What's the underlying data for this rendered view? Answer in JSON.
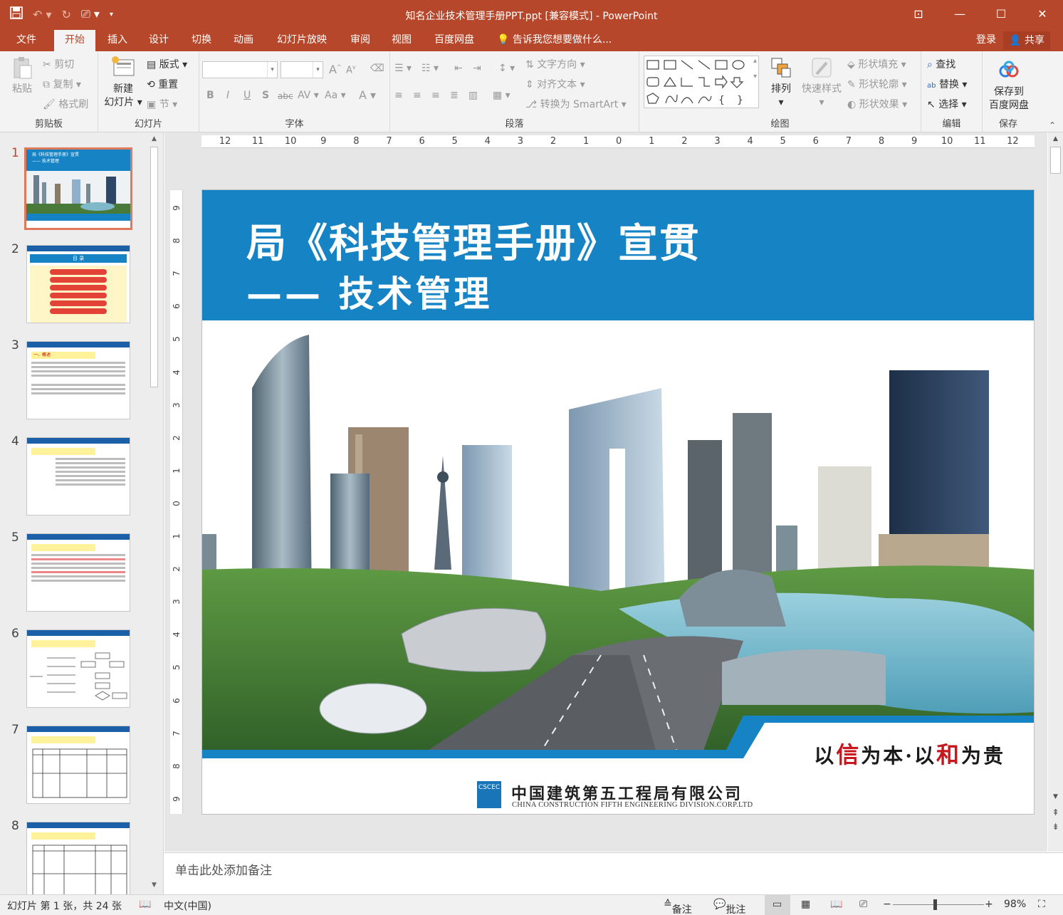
{
  "window": {
    "title": "知名企业技术管理手册PPT.ppt [兼容模式] - PowerPoint",
    "controls": [
      "⊡",
      "—",
      "☐",
      "✕"
    ]
  },
  "menu": {
    "tabs": [
      "文件",
      "开始",
      "插入",
      "设计",
      "切换",
      "动画",
      "幻灯片放映",
      "审阅",
      "视图",
      "百度网盘"
    ],
    "tell_me": "告诉我您想要做什么...",
    "login": "登录",
    "share": "共享"
  },
  "ribbon": {
    "clipboard": {
      "label": "剪贴板",
      "paste": "粘贴",
      "cut": "剪切",
      "copy": "复制",
      "format_painter": "格式刷"
    },
    "slides": {
      "label": "幻灯片",
      "new_slide_1": "新建",
      "new_slide_2": "幻灯片",
      "layout": "版式",
      "reset": "重置",
      "section": "节"
    },
    "font": {
      "label": "字体",
      "bold": "B",
      "italic": "I",
      "underline": "U",
      "shadow": "S",
      "strike": "abc",
      "spacing": "AV",
      "case": "Aa",
      "color": "A",
      "grow": "A",
      "shrink": "A"
    },
    "paragraph": {
      "label": "段落",
      "text_direction": "文字方向",
      "align_text": "对齐文本",
      "smartart": "转换为 SmartArt"
    },
    "drawing": {
      "label": "绘图",
      "arrange": "排列",
      "quick_styles": "快速样式",
      "shape_fill": "形状填充",
      "shape_outline": "形状轮廓",
      "shape_effects": "形状效果"
    },
    "editing": {
      "label": "编辑",
      "find": "查找",
      "replace": "替换",
      "select": "选择"
    },
    "save": {
      "label": "保存",
      "save_to_1": "保存到",
      "save_to_2": "百度网盘"
    }
  },
  "thumbnails": {
    "numbers": [
      "1",
      "2",
      "3",
      "4",
      "5",
      "6",
      "7",
      "8"
    ],
    "slide1_title": "局《科技管理手册》宣贯",
    "slide1_sub": "—— 技术管理",
    "slide2_head": "目 录",
    "section_heading": "一、概述"
  },
  "slide": {
    "title": "局《科技管理手册》宣贯",
    "subtitle": "——  技术管理",
    "motto_a": "以",
    "motto_b": "信",
    "motto_c": "为本·以",
    "motto_d": "和",
    "motto_e": "为贵",
    "company_cn": "中国建筑第五工程局有限公司",
    "company_en": "CHINA CONSTRUCTION FIFTH ENGINEERING DIVISION.CORP.LTD",
    "logo_text": "CSCEC"
  },
  "hruler": [
    "12",
    "11",
    "10",
    "9",
    "8",
    "7",
    "6",
    "5",
    "4",
    "3",
    "2",
    "1",
    "0",
    "1",
    "2",
    "3",
    "4",
    "5",
    "6",
    "7",
    "8",
    "9",
    "10",
    "11",
    "12"
  ],
  "vruler": [
    "9",
    "8",
    "7",
    "6",
    "5",
    "4",
    "3",
    "2",
    "1",
    "0",
    "1",
    "2",
    "3",
    "4",
    "5",
    "6",
    "7",
    "8",
    "9"
  ],
  "notes": {
    "placeholder": "单击此处添加备注"
  },
  "status": {
    "slide_info": "幻灯片 第 1 张，共 24 张",
    "language": "中文(中国)",
    "notes": "备注",
    "comments": "批注",
    "zoom": "98%"
  },
  "colors": {
    "accent": "#b7472a",
    "slide_blue": "#1684c4"
  }
}
